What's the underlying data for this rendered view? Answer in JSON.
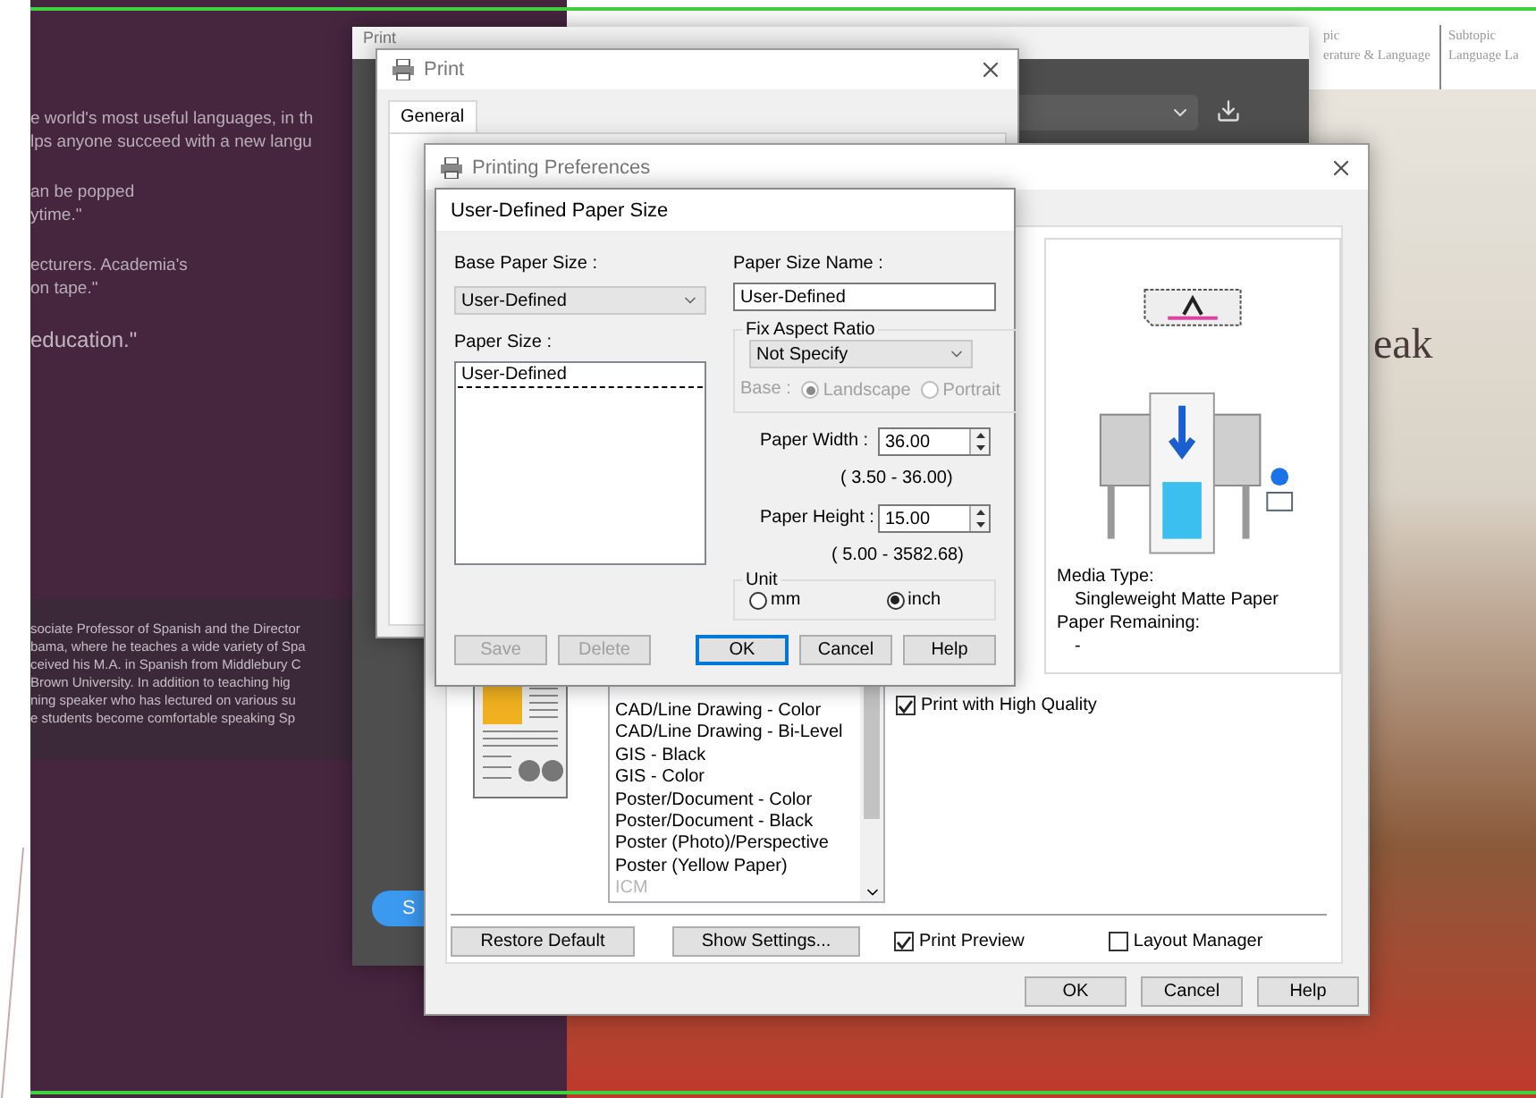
{
  "background_page": {
    "quote_paragraphs": [
      [
        "e world's most useful languages, in th",
        "lps anyone succeed with a new langu"
      ],
      [
        "an be popped",
        "ytime.\""
      ],
      [
        "ecturers. Academia's",
        "on tape.\""
      ]
    ],
    "tagline": "education.\"",
    "bio_lines": [
      "sociate Professor of Spanish and the Director",
      "bama, where he teaches a wide variety of Spa",
      "ceived his M.A. in Spanish from Middlebury C",
      "Brown University. In addition to teaching hig",
      "ning speaker who has lectured on various su",
      "e students become comfortable speaking Sp"
    ],
    "nav": [
      {
        "line1": "pic",
        "line2": "erature & Language"
      },
      {
        "line1": "Subtopic",
        "line2": "Language La"
      }
    ],
    "heading": "eak"
  },
  "web_print_window": {
    "title": "Print",
    "button": "S"
  },
  "print_dialog": {
    "title": "Print",
    "tabs": [
      {
        "label": "General",
        "selected": true
      }
    ]
  },
  "preferences": {
    "title": "Printing Preferences",
    "media_type_label": "Media Type:",
    "media_type": "Singleweight Matte Paper",
    "paper_remaining_label": "Paper Remaining:",
    "paper_remaining": "-",
    "quality_list": [
      {
        "label": "CAD/Line Drawing - Color",
        "disabled": false
      },
      {
        "label": "CAD/Line Drawing - Bi-Level",
        "disabled": false
      },
      {
        "label": "GIS - Black",
        "disabled": false
      },
      {
        "label": "GIS - Color",
        "disabled": false
      },
      {
        "label": "Poster/Document - Color",
        "disabled": false
      },
      {
        "label": "Poster/Document - Black",
        "disabled": false
      },
      {
        "label": "Poster (Photo)/Perspective",
        "disabled": false
      },
      {
        "label": "Poster (Yellow Paper)",
        "disabled": false
      },
      {
        "label": "ICM",
        "disabled": true
      }
    ],
    "high_quality": {
      "label": "Print with High Quality",
      "checked": true
    },
    "restore_button": "Restore Default",
    "show_settings_button": "Show Settings...",
    "print_preview": {
      "label": "Print Preview",
      "checked": true
    },
    "layout_manager": {
      "label": "Layout Manager",
      "checked": false
    },
    "buttons": [
      "OK",
      "Cancel",
      "Help"
    ]
  },
  "paper_dialog": {
    "title": "User-Defined Paper Size",
    "base_label": "Base Paper Size :",
    "base_value": "User-Defined",
    "paper_size_label": "Paper Size :",
    "paper_sizes": [
      {
        "label": "User-Defined",
        "selected": true
      }
    ],
    "name_label": "Paper Size Name :",
    "name_value": "User-Defined",
    "aspect_group": "Fix Aspect Ratio",
    "aspect_value": "Not Specify",
    "base_label2": "Base :",
    "orientations": [
      {
        "label": "Landscape",
        "selected": true,
        "disabled": true
      },
      {
        "label": "Portrait",
        "selected": false,
        "disabled": true
      }
    ],
    "width_label": "Paper Width  :",
    "width_value": "36.00",
    "width_range": "( 3.50 - 36.00)",
    "height_label": "Paper Height :",
    "height_value": "15.00",
    "height_range": "( 5.00 - 3582.68)",
    "unit_group": "Unit",
    "units": [
      {
        "label": "mm",
        "selected": false
      },
      {
        "label": "inch",
        "selected": true
      }
    ],
    "buttons": [
      {
        "label": "Save",
        "disabled": true,
        "default": false
      },
      {
        "label": "Delete",
        "disabled": true,
        "default": false
      },
      {
        "label": "OK",
        "disabled": false,
        "default": true
      },
      {
        "label": "Cancel",
        "disabled": false,
        "default": false
      },
      {
        "label": "Help",
        "disabled": false,
        "default": false
      }
    ]
  }
}
